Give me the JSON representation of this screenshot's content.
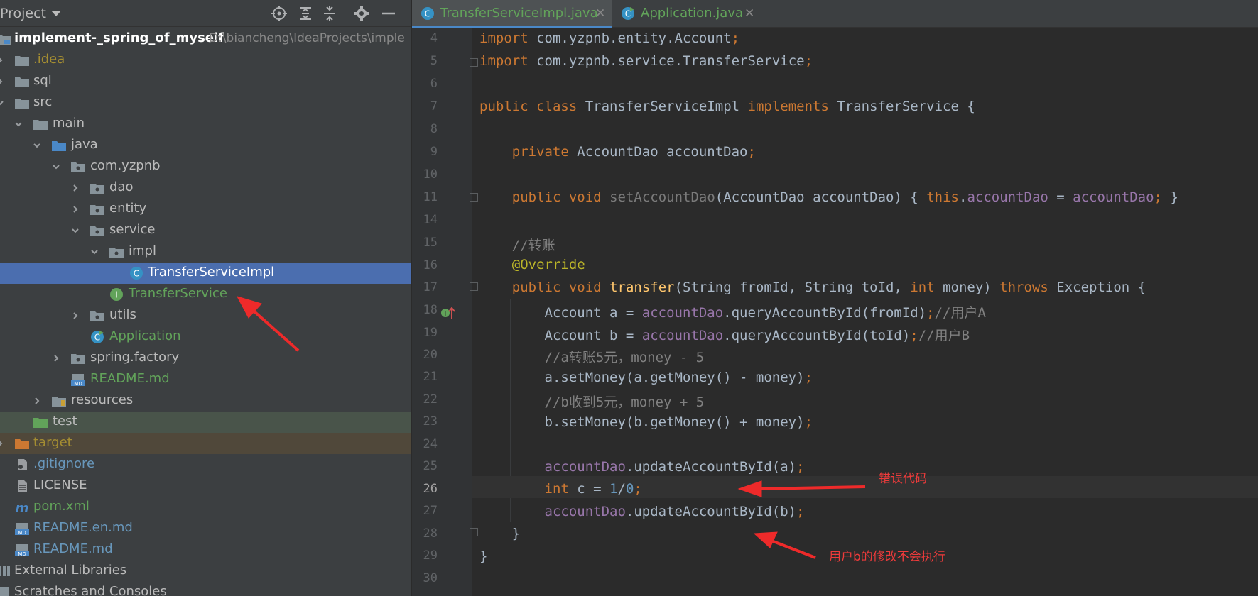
{
  "project_panel": {
    "title": "Project",
    "header_icons": [
      "locate-icon",
      "expand-all-icon",
      "collapse-all-icon",
      "gear-icon",
      "minimize-icon"
    ],
    "tree": [
      {
        "label": "implement-_spring_of_myself",
        "path": "D:\\biancheng\\IdeaProjects\\imple",
        "type": "module",
        "expanded": true
      },
      {
        "label": ".idea",
        "type": "folder",
        "expanded": false
      },
      {
        "label": "sql",
        "type": "folder",
        "expanded": false
      },
      {
        "label": "src",
        "type": "folder",
        "expanded": true
      },
      {
        "label": "main",
        "type": "folder",
        "expanded": true
      },
      {
        "label": "java",
        "type": "source-folder",
        "expanded": true
      },
      {
        "label": "com.yzpnb",
        "type": "package",
        "expanded": true
      },
      {
        "label": "dao",
        "type": "package",
        "expanded": false
      },
      {
        "label": "entity",
        "type": "package",
        "expanded": false
      },
      {
        "label": "service",
        "type": "package",
        "expanded": true
      },
      {
        "label": "impl",
        "type": "package",
        "expanded": true
      },
      {
        "label": "TransferServiceImpl",
        "type": "class",
        "selected": true
      },
      {
        "label": "TransferService",
        "type": "interface"
      },
      {
        "label": "utils",
        "type": "package",
        "expanded": false
      },
      {
        "label": "Application",
        "type": "main-class"
      },
      {
        "label": "spring.factory",
        "type": "package",
        "expanded": false
      },
      {
        "label": "README.md",
        "type": "markdown"
      },
      {
        "label": "resources",
        "type": "resources-folder",
        "expanded": false
      },
      {
        "label": "test",
        "type": "test-folder"
      },
      {
        "label": "target",
        "type": "excluded-folder",
        "expanded": false
      },
      {
        "label": ".gitignore",
        "type": "gitignore"
      },
      {
        "label": "LICENSE",
        "type": "text"
      },
      {
        "label": "pom.xml",
        "type": "maven"
      },
      {
        "label": "README.en.md",
        "type": "markdown"
      },
      {
        "label": "README.md",
        "type": "markdown"
      },
      {
        "label": "External Libraries",
        "type": "libraries"
      },
      {
        "label": "Scratches and Consoles",
        "type": "scratches"
      }
    ]
  },
  "editor": {
    "tabs": [
      {
        "label": "TransferServiceImpl.java",
        "active": true
      },
      {
        "label": "Application.java",
        "active": false
      }
    ],
    "current_line": 26,
    "lines": [
      {
        "num": "4",
        "code": "import com.yzpnb.entity.Account;"
      },
      {
        "num": "5",
        "code": "import com.yzpnb.service.TransferService;"
      },
      {
        "num": "6",
        "code": ""
      },
      {
        "num": "7",
        "code": "public class TransferServiceImpl implements TransferService {"
      },
      {
        "num": "8",
        "code": ""
      },
      {
        "num": "9",
        "code": "    private AccountDao accountDao;"
      },
      {
        "num": "10",
        "code": ""
      },
      {
        "num": "11",
        "code": "    public void setAccountDao(AccountDao accountDao) { this.accountDao = accountDao; }"
      },
      {
        "num": "14",
        "code": ""
      },
      {
        "num": "15",
        "code": "    //转账"
      },
      {
        "num": "16",
        "code": "    @Override"
      },
      {
        "num": "17",
        "code": "    public void transfer(String fromId, String toId, int money) throws Exception {"
      },
      {
        "num": "18",
        "code": "        Account a = accountDao.queryAccountById(fromId);//用户A"
      },
      {
        "num": "19",
        "code": "        Account b = accountDao.queryAccountById(toId);//用户B"
      },
      {
        "num": "20",
        "code": "        //a转账5元，money - 5"
      },
      {
        "num": "21",
        "code": "        a.setMoney(a.getMoney() - money);"
      },
      {
        "num": "22",
        "code": "        //b收到5元，money + 5"
      },
      {
        "num": "23",
        "code": "        b.setMoney(b.getMoney() + money);"
      },
      {
        "num": "24",
        "code": ""
      },
      {
        "num": "25",
        "code": "        accountDao.updateAccountById(a);"
      },
      {
        "num": "26",
        "code": "        int c = 1/0;"
      },
      {
        "num": "27",
        "code": "        accountDao.updateAccountById(b);"
      },
      {
        "num": "28",
        "code": "    }"
      },
      {
        "num": "29",
        "code": "}"
      },
      {
        "num": "30",
        "code": ""
      }
    ]
  },
  "annotations": {
    "error_code_note": "错误代码",
    "user_b_note": "用户b的修改不会执行"
  },
  "colors": {
    "panel_bg": "#3c3f41",
    "editor_bg": "#2b2b2b",
    "selection": "#4b6eaf",
    "keyword": "#cc7832",
    "field": "#9876aa",
    "method": "#ffc66d",
    "comment": "#808080",
    "annotation_red": "#ee3b3b"
  }
}
